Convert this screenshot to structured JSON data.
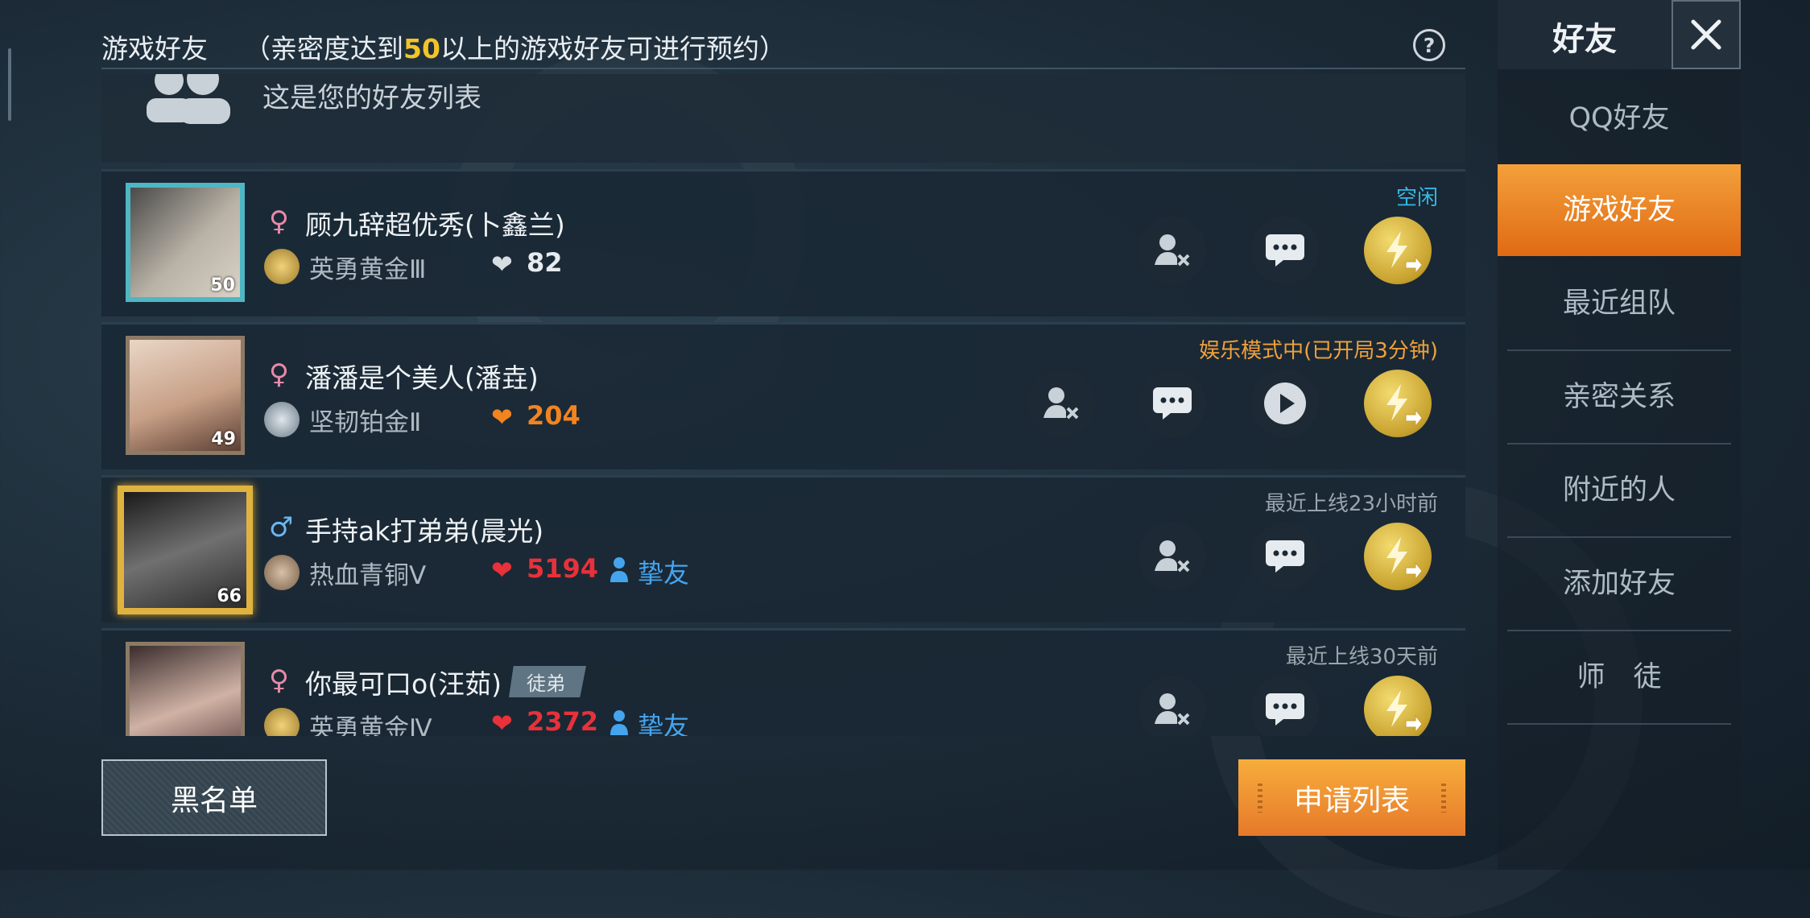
{
  "header": {
    "title": "游戏好友",
    "note_prefix": "（亲密度达到",
    "note_highlight": "50",
    "note_suffix": "以上的游戏好友可进行预约）"
  },
  "intro": {
    "text": "这是您的好友列表"
  },
  "friends": [
    {
      "gender": "♀",
      "name": "顾九辞超优秀(卜鑫兰)",
      "rank": "英勇黄金Ⅲ",
      "intimacy": "82",
      "status": "空闲",
      "level": "50"
    },
    {
      "gender": "♀",
      "name": "潘潘是个美人(潘垚)",
      "rank": "坚韧铂金Ⅱ",
      "intimacy": "204",
      "status": "娱乐模式中(已开局3分钟)",
      "level": "49"
    },
    {
      "gender": "♂",
      "name": "手持ak打弟弟(晨光)",
      "rank": "热血青铜Ⅴ",
      "intimacy": "5194",
      "relation": "挚友",
      "status": "最近上线23小时前",
      "level": "66"
    },
    {
      "gender": "♀",
      "name": "你最可口o(汪茹)",
      "tag": "徒弟",
      "rank": "英勇黄金Ⅳ",
      "intimacy": "2372",
      "relation": "挚友",
      "status": "最近上线30天前"
    }
  ],
  "sidebar": {
    "title": "好友",
    "items": [
      "QQ好友",
      "游戏好友",
      "最近组队",
      "亲密关系",
      "附近的人",
      "添加好友",
      "师　徒"
    ]
  },
  "footer": {
    "blacklist_label": "黑名单",
    "apply_label": "申请列表"
  },
  "icons": {
    "help": "question-circle-icon",
    "close": "close-icon",
    "remove_friend": "remove-friend-icon",
    "chat": "chat-bubble-icon",
    "watch": "play-icon",
    "invite": "lightning-invite-icon"
  },
  "colors": {
    "accent_orange": "#f0902a",
    "status_idle": "#35b8e6",
    "status_playing": "#f0a13a",
    "status_offline": "#9aa5ad",
    "heart_high": "#e8313a",
    "heart_mid": "#f2841f",
    "heart_low": "#d8dde2",
    "relation_blue": "#45a4ee"
  }
}
